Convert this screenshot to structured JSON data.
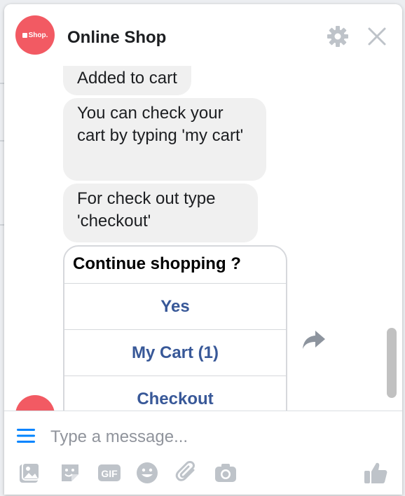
{
  "header": {
    "avatar_text": "Shop.",
    "title": "Online Shop",
    "settings_icon": "gear-icon",
    "close_icon": "close-icon"
  },
  "messages": [
    {
      "text": "Added to cart"
    },
    {
      "text": "You can check your cart by typing 'my cart'"
    },
    {
      "text": "For check out type 'checkout'"
    }
  ],
  "card": {
    "title": "Continue shopping ?",
    "buttons": [
      "Yes",
      "My Cart (1)",
      "Checkout"
    ]
  },
  "composer": {
    "placeholder": "Type a message...",
    "tools": [
      "photo-icon",
      "sticker-icon",
      "gif-icon",
      "emoji-icon",
      "attachment-icon",
      "camera-icon"
    ],
    "gif_label": "GIF"
  },
  "colors": {
    "accent": "#385898",
    "avatar": "#f25a63",
    "bubble": "#f0f0f0"
  }
}
